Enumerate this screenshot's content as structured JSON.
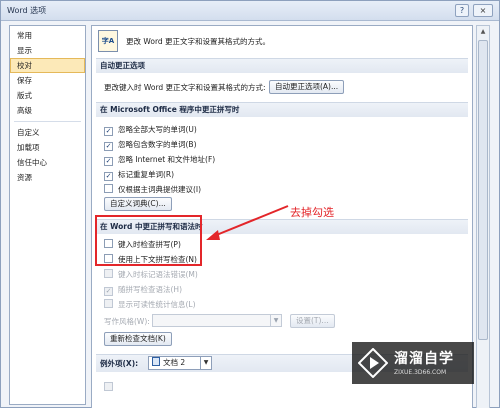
{
  "window": {
    "title": "Word 选项",
    "help": "?",
    "close": "×"
  },
  "sidebar": {
    "items": [
      {
        "label": "常用",
        "active": false
      },
      {
        "label": "显示",
        "active": false
      },
      {
        "label": "校对",
        "active": true
      },
      {
        "label": "保存",
        "active": false
      },
      {
        "label": "版式",
        "active": false
      },
      {
        "label": "高级",
        "active": false
      },
      {
        "label": "自定义",
        "active": false
      },
      {
        "label": "加载项",
        "active": false
      },
      {
        "label": "信任中心",
        "active": false
      },
      {
        "label": "资源",
        "active": false
      }
    ]
  },
  "header": {
    "icon_text": "字A",
    "text": "更改 Word 更正文字和设置其格式的方式。"
  },
  "autocorrect": {
    "title": "自动更正选项",
    "desc": "更改键入时 Word 更正文字和设置其格式的方式:",
    "button": "自动更正选项(A)..."
  },
  "office_spelling": {
    "title": "在 Microsoft Office 程序中更正拼写时",
    "options": [
      {
        "label": "忽略全部大写的单词(U)",
        "checked": true
      },
      {
        "label": "忽略包含数字的单词(B)",
        "checked": true
      },
      {
        "label": "忽略 Internet 和文件地址(F)",
        "checked": true
      },
      {
        "label": "标记重复单词(R)",
        "checked": true
      },
      {
        "label": "仅根据主词典提供建议(I)",
        "checked": false
      }
    ],
    "custom_dict_button": "自定义词典(C)..."
  },
  "word_spelling": {
    "title": "在 Word 中更正拼写和语法时",
    "options": [
      {
        "label": "键入时检查拼写(P)",
        "checked": false,
        "disabled": false
      },
      {
        "label": "使用上下文拼写检查(N)",
        "checked": false,
        "disabled": false
      },
      {
        "label": "键入时标记语法错误(M)",
        "checked": false,
        "disabled": true
      },
      {
        "label": "随拼写检查语法(H)",
        "checked": true,
        "disabled": true
      },
      {
        "label": "显示可读性统计信息(L)",
        "checked": false,
        "disabled": true
      }
    ],
    "writing_style_label": "写作风格(W):",
    "settings_button": "设置(T)...",
    "recheck_button": "重新检查文档(K)"
  },
  "exceptions": {
    "label": "例外项(X):",
    "doc": "文档 2"
  },
  "annotation": {
    "text": "去掉勾选",
    "color": "#e3262a"
  },
  "watermark": {
    "title": "溜溜自学",
    "url": "ZIXUE.3D66.COM"
  }
}
